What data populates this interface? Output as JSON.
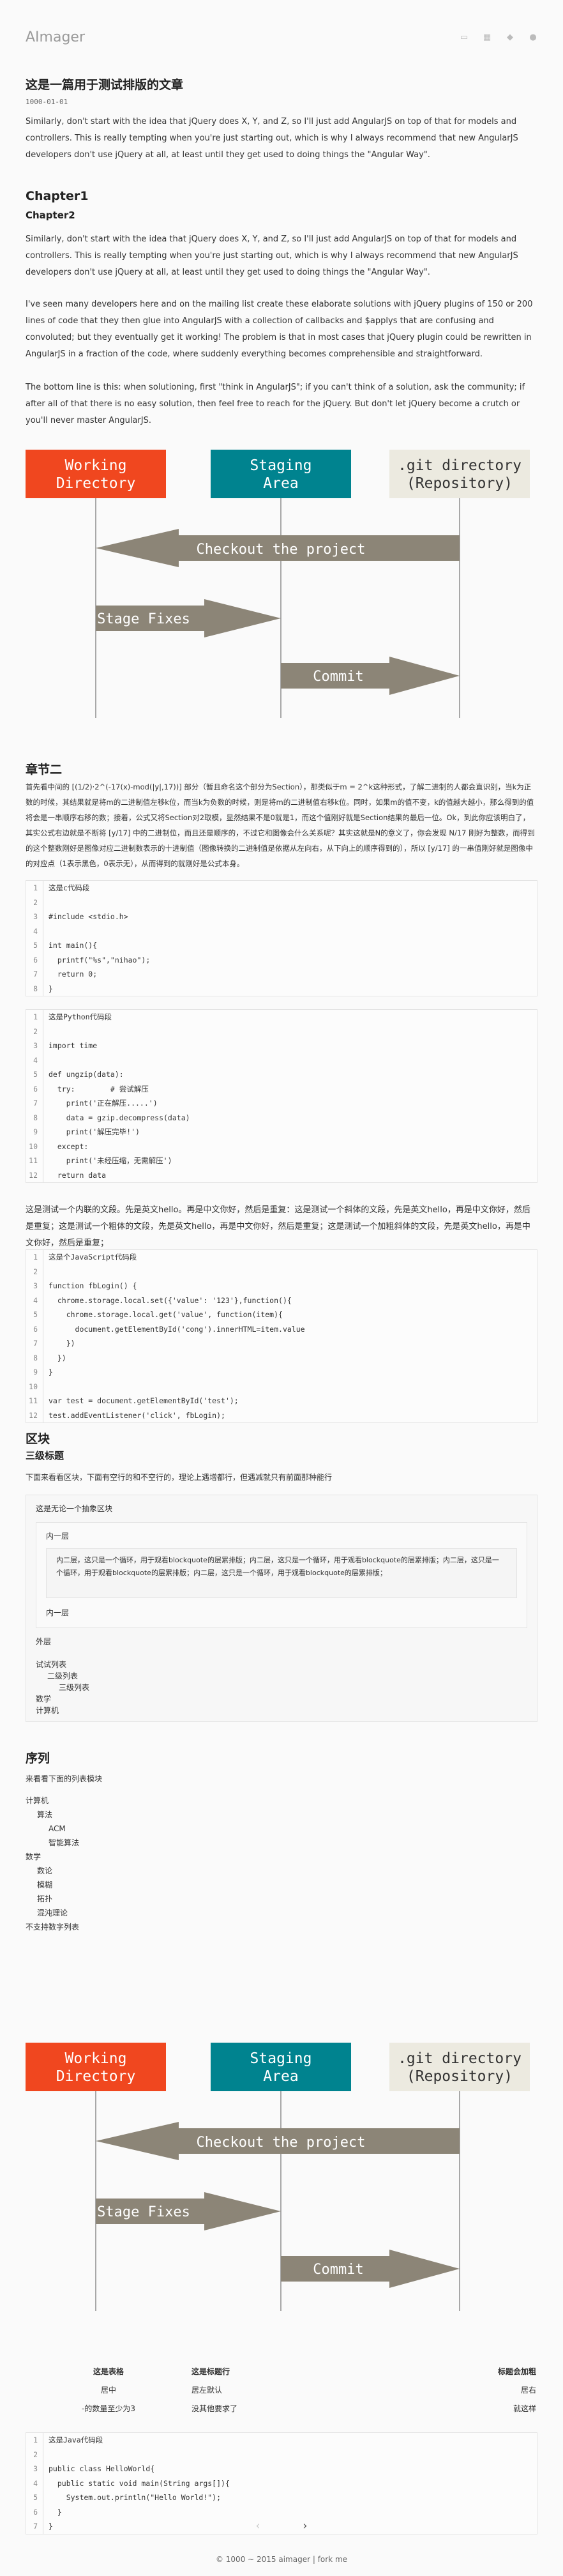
{
  "site": {
    "name": "AImager",
    "header_icons": [
      "chat-icon",
      "image-icon",
      "tag-icon",
      "user-icon"
    ]
  },
  "post": {
    "title": "这是一篇用于测试排版的文章",
    "date": "1000-01-01",
    "intro": "Similarly, don't start with the idea that jQuery does X, Y, and Z, so I'll just add AngularJS on top of that for models and controllers. This is really tempting when you're just starting out, which is why I always recommend that new AngularJS developers don't use jQuery at all, at least until they get used to doing things the \"Angular Way\"."
  },
  "chapter1": {
    "h1": "Chapter1",
    "h2": "Chapter2",
    "p1": "Similarly, don't start with the idea that jQuery does X, Y, and Z, so I'll just add AngularJS on top of that for models and controllers. This is really tempting when you're just starting out, which is why I always recommend that new AngularJS developers don't use jQuery at all, at least until they get used to doing things the \"Angular Way\".",
    "p2": "I've seen many developers here and on the mailing list create these elaborate solutions with jQuery plugins of 150 or 200 lines of code that they then glue into AngularJS with a collection of callbacks and $applys that are confusing and convoluted; but they eventually get it working! The problem is that in most cases that jQuery plugin could be rewritten in AngularJS in a fraction of the code, where suddenly everything becomes comprehensible and straightforward.",
    "p3": "The bottom line is this: when solutioning, first \"think in AngularJS\"; if you can't think of a solution, ask the community; if after all of that there is no easy solution, then feel free to reach for the jQuery. But don't let jQuery become a crutch or you'll never master AngularJS."
  },
  "diagram": {
    "boxes": [
      "Working\nDirectory",
      "Staging\nArea",
      ".git directory\n(Repository)"
    ],
    "arrows": [
      "Checkout the project",
      "Stage Fixes",
      "Commit"
    ],
    "colors": {
      "working": "#f0471f",
      "staging": "#00838f",
      "repo": "#eceae0",
      "arrow": "#8c8577"
    }
  },
  "chapter2": {
    "h": "章节二",
    "p": "首先看中间的 [(1/2)·2^(-17(x)-mod(|y|,17))] 部分（暂且命名这个部分为Section），那类似于m = 2^k这种形式，了解二进制的人都会直识别，当k为正数的时候，其结果就是将m的二进制值左移k位，而当k为负数的时候，则是将m的二进制值右移k位。同时，如果m的值不变，k的值越大越小，那么得到的值将会是一串顺序右移的数；接着，公式又将Section对2取模，显然结果不是0就是1，而这个值刚好就是Section结果的最后一位。Ok，到此你应该明白了，其实公式右边就是不断将 [y/17] 中的二进制位，而且还是顺序的，不过它和图像会什么关系呢？其实这就是N的意义了，你会发现 N/17 刚好为整数，而得到的这个整数刚好是图像对应二进制数表示的十进制值（图像转换的二进制值是依据从左向右，从下向上的顺序得到的），所以 [y/17] 的一串值刚好就是图像中的对应点（1表示黑色，0表示无），从而得到的就刚好是公式本身。",
    "code_c": [
      "这是c代码段",
      "",
      "#include <stdio.h>",
      "",
      "int main(){",
      "  printf(\"%s\",\"nihao\");",
      "  return 0;",
      "}"
    ],
    "code_py": [
      "这是Python代码段",
      "",
      "import time",
      "",
      "def ungzip(data):",
      "  try:        # 尝试解压",
      "    print('正在解压.....')",
      "    data = gzip.decompress(data)",
      "    print('解压完毕!')",
      "  except:",
      "    print('未经压缩，无需解压')",
      "  return data"
    ],
    "mix_text": "这是测试一个内联的文段。先是英文hello。再是中文你好，然后是重复：这是测试一个斜体的文段，先是英文hello，再是中文你好，然后是重复；这是测试一个粗体的文段，先是英文hello，再是中文你好，然后是重复；这是测试一个加粗斜体的文段，先是英文hello，再是中文你好，然后是重复；",
    "code_js": [
      "这是个JavaScript代码段",
      "",
      "function fbLogin() {",
      "  chrome.storage.local.set({'value': '123'},function(){",
      "    chrome.storage.local.get('value', function(item){",
      "      document.getElementById('cong').innerHTML=item.value",
      "    })",
      "  })",
      "}",
      "",
      "var test = document.getElementById('test');",
      "test.addEventListener('click', fbLogin);"
    ]
  },
  "blocks": {
    "h": "区块",
    "h3": "三级标题",
    "intro": "下面来看看区块，下面有空行的和不空行的，理论上遇增都行，但遇减就只有前面那种能行",
    "outer_title": "这是无论一个抽象区块",
    "inner_label": "内一层",
    "inner_text": "内二层，这只是一个循环，用于观看blockquote的层累排版；内二层，这只是一个循环，用于观看blockquote的层累排版；内二层，这只是一个循环，用于观看blockquote的层累排版；内二层，这只是一个循环，用于观看blockquote的层累排版；",
    "inner_label2": "内一层",
    "outer_label": "外层",
    "list": [
      "试试列表",
      "二级列表",
      "三级列表",
      "数学",
      "计算机"
    ]
  },
  "sequence": {
    "h": "序列",
    "intro": "来看看下面的列表模块",
    "items": [
      "计算机",
      "算法",
      "ACM",
      "智能算法",
      "数学",
      "数论",
      "模糊",
      "拓扑",
      "混沌理论"
    ],
    "no_nums": "不支持数字列表"
  },
  "table": {
    "headers": [
      "这是表格",
      "这是标题行",
      "标题会加粗"
    ],
    "rows": [
      [
        "居中",
        "居左默认",
        "居右"
      ],
      [
        "-的数量至少为3",
        "没其他要求了",
        "就这样"
      ]
    ]
  },
  "code_java": [
    "这是Java代码段",
    "",
    "public class HelloWorld{",
    "  public static void main(String args[]){",
    "    System.out.println(\"Hello World!\");",
    "  }",
    "}"
  ],
  "pager": {
    "prev": "‹",
    "next": "›"
  },
  "footer": {
    "text": "© 1000 ~ 2015 aimager | fork me"
  }
}
